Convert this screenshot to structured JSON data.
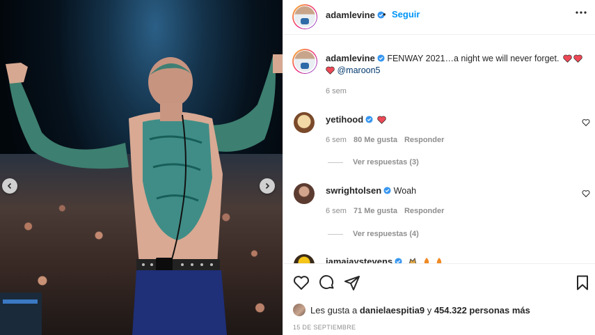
{
  "post": {
    "author": "adamlevine",
    "follow_label": "Seguir",
    "separator": "•",
    "caption": {
      "text": "FENWAY 2021…a night we will never forget.",
      "mention": "@maroon5",
      "time": "6 sem"
    },
    "likes": {
      "prefix": "Les gusta a",
      "user": "danielaespitia9",
      "middle": "y",
      "count": "454.322 personas más"
    },
    "date": "15 DE SEPTIEMBRE"
  },
  "comments": [
    {
      "user": "yetihood",
      "text": "",
      "time": "6 sem",
      "likes": "80 Me gusta",
      "reply_label": "Responder",
      "view_replies": "Ver respuestas (3)"
    },
    {
      "user": "swrightolsen",
      "text": "Woah",
      "time": "6 sem",
      "likes": "71 Me gusta",
      "reply_label": "Responder",
      "view_replies": "Ver respuestas (4)"
    },
    {
      "user": "jamaiaystevens",
      "text": "",
      "time": "",
      "likes": "",
      "reply_label": "",
      "view_replies": ""
    }
  ],
  "icons": {
    "verified": "verified-badge-icon",
    "more": "more-options-icon",
    "like": "heart-outline-icon",
    "comment": "comment-icon",
    "share": "send-icon",
    "save": "bookmark-icon",
    "prev": "chevron-left-icon",
    "next": "chevron-right-icon"
  },
  "colors": {
    "accent_blue": "#0095f6",
    "verified_blue": "#3897f0",
    "heart_red": "#ed4956",
    "muted": "#8e8e8e"
  }
}
